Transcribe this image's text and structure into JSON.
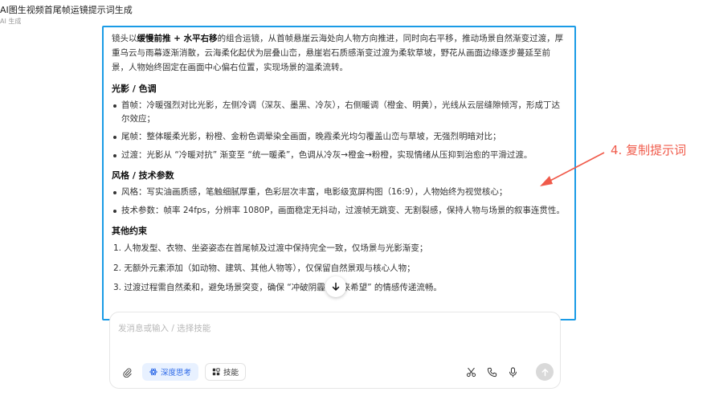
{
  "header": {
    "title": "AI图生视频首尾帧运镜提示词生成",
    "subtitle": "AI 生成"
  },
  "content": {
    "intro_pre": "镜头以",
    "intro_bold": "缓慢前推 + 水平右移",
    "intro_post": "的组合运镜，从首帧悬崖云海处向人物方向推进，同时向右平移，推动场景自然渐变过渡，厚重乌云与雨幕逐渐消散，云海柔化起伏为层叠山峦，悬崖岩石质感渐变过渡为柔软草坡，野花从画面边缘逐步蔓延至前景，人物始终固定在画面中心偏右位置，实现场景的温柔流转。",
    "section_light": {
      "title": "光影 / 色调",
      "items": [
        "首帧：冷暖强烈对比光影，左侧冷调（深灰、墨黑、冷灰），右侧暖调（橙金、明黄），光线从云层缝隙倾泻，形成丁达尔效应；",
        "尾帧：整体暖柔光影，粉橙、金粉色调晕染全画面，晚霞柔光均匀覆盖山峦与草坡，无强烈明暗对比；",
        "过渡：光影从 “冷暖对抗” 渐变至 “统一暖柔”，色调从冷灰→橙金→粉橙，实现情绪从压抑到治愈的平滑过渡。"
      ]
    },
    "section_style": {
      "title": "风格 / 技术参数",
      "items": [
        "风格：写实油画质感，笔触细腻厚重，色彩层次丰富，电影级宽屏构图（16:9），人物始终为视觉核心；",
        "技术参数：帧率 24fps，分辨率 1080P，画面稳定无抖动，过渡帧无跳变、无割裂感，保持人物与场景的叙事连贯性。"
      ]
    },
    "section_other": {
      "title": "其他约束",
      "items": [
        "1. 人物发型、衣物、坐姿姿态在首尾帧及过渡中保持完全一致，仅场景与光影渐变；",
        "2. 无额外元素添加（如动物、建筑、其他人物等），仅保留自然景观与核心人物；",
        "3. 过渡过程需自然柔和，避免场景突变，确保 “冲破阴霾，迎来希望” 的情感传递流畅。"
      ]
    }
  },
  "input": {
    "placeholder": "发消息或输入 / 选择技能",
    "deep_think_label": "深度思考",
    "skills_label": "技能"
  },
  "annotation": {
    "text": "4. 复制提示词",
    "color": "#f05a4a"
  },
  "colors": {
    "highlight_border": "#1a9be6",
    "accent": "#2f6be8"
  }
}
